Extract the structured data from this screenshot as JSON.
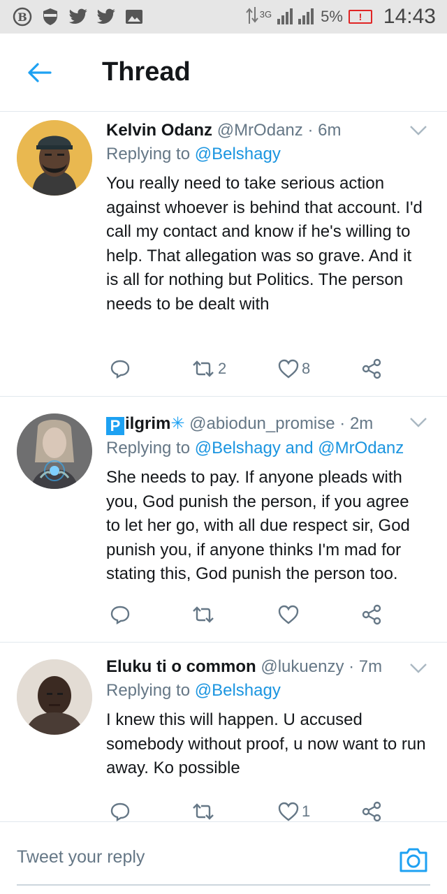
{
  "status_bar": {
    "network": "3G",
    "battery": "5%",
    "time": "14:43"
  },
  "header": {
    "title": "Thread"
  },
  "tweets": [
    {
      "name": "Kelvin Odanz",
      "handle": "@MrOdanz",
      "time": "· 6m",
      "replying_prefix": "Replying to",
      "replying_to": "@Belshagy",
      "text": "You really need to take serious action against whoever is behind that account. I'd call my contact and know if he's willing to help. That allegation was so grave. And it is all for nothing but Politics. The person needs to be dealt with",
      "retweets": "2",
      "likes": "8"
    },
    {
      "name_badge": "P",
      "name": "ilgrim",
      "name_symbol": "✳",
      "handle": "@abiodun_promise",
      "time": "· 2m",
      "replying_prefix": "Replying to",
      "replying_to": "@Belshagy and @MrOdanz",
      "text": "She needs to pay. If anyone pleads with you, God punish the person, if you agree to let her go, with all due respect sir, God punish you, if anyone thinks I'm mad for stating this, God punish the person too.",
      "retweets": "",
      "likes": ""
    },
    {
      "name": "Eluku ti o common",
      "handle": "@lukuenzy",
      "time": "· 7m",
      "replying_prefix": "Replying to",
      "replying_to": "@Belshagy",
      "text": "I knew this will happen. U accused somebody without proof,  u now want to run away. Ko possible",
      "retweets": "",
      "likes": "1"
    }
  ],
  "composer": {
    "placeholder": "Tweet your reply"
  },
  "colors": {
    "accent": "#1da1f2",
    "mention": "#1b95e0",
    "secondary_text": "#657786",
    "divider": "#e1e8ed"
  },
  "icons": {
    "status": [
      "b-circle-icon",
      "shield-icon",
      "twitter-bird-icon",
      "twitter-bird-icon",
      "image-icon",
      "data-arrows-icon",
      "signal-icon",
      "battery-icon"
    ],
    "header": [
      "back-arrow-icon"
    ],
    "actions": [
      "reply-icon",
      "retweet-icon",
      "like-icon",
      "share-icon"
    ],
    "composer": [
      "camera-icon"
    ]
  }
}
